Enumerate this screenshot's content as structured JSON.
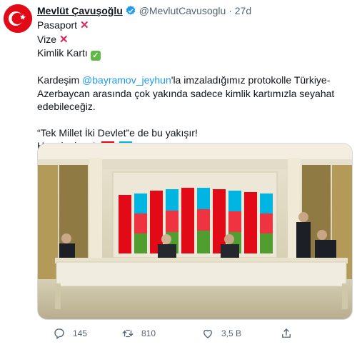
{
  "tweet": {
    "author_name": "Mevlüt Çavuşoğlu",
    "handle": "@MevlutCavusoglu",
    "separator": "·",
    "time": "27d",
    "lines": {
      "l1": "Pasaport",
      "l2": "Vize",
      "l3": "Kimlik Kartı",
      "p1_before": "Kardeşim ",
      "p1_mention": "@bayramov_jeyhun",
      "p1_after": "'la imzaladığımız protokolle Türkiye-",
      "p1_line2": "Azerbaycan arasında çok yakında sadece kimlik kartımızla seyahat",
      "p1_line3": "edebileceğiz.",
      "p2_line1": "“Tek Millet İki Devlet”e de bu yakışır!",
      "p2_line2": "Hayırlı olsun!"
    },
    "icons": {
      "cross": "cross-mark-icon",
      "check": "check-mark-button-icon",
      "flag_tr": "turkey-flag-icon",
      "flag_az": "azerbaijan-flag-icon"
    },
    "colors": {
      "link": "#1d9bf0",
      "cross": "#e0245e",
      "check": "#5fb947",
      "turkey_red": "#e30a17"
    }
  },
  "actions": {
    "reply_count": "145",
    "retweet_count": "810",
    "like_count": "3,5 B"
  }
}
